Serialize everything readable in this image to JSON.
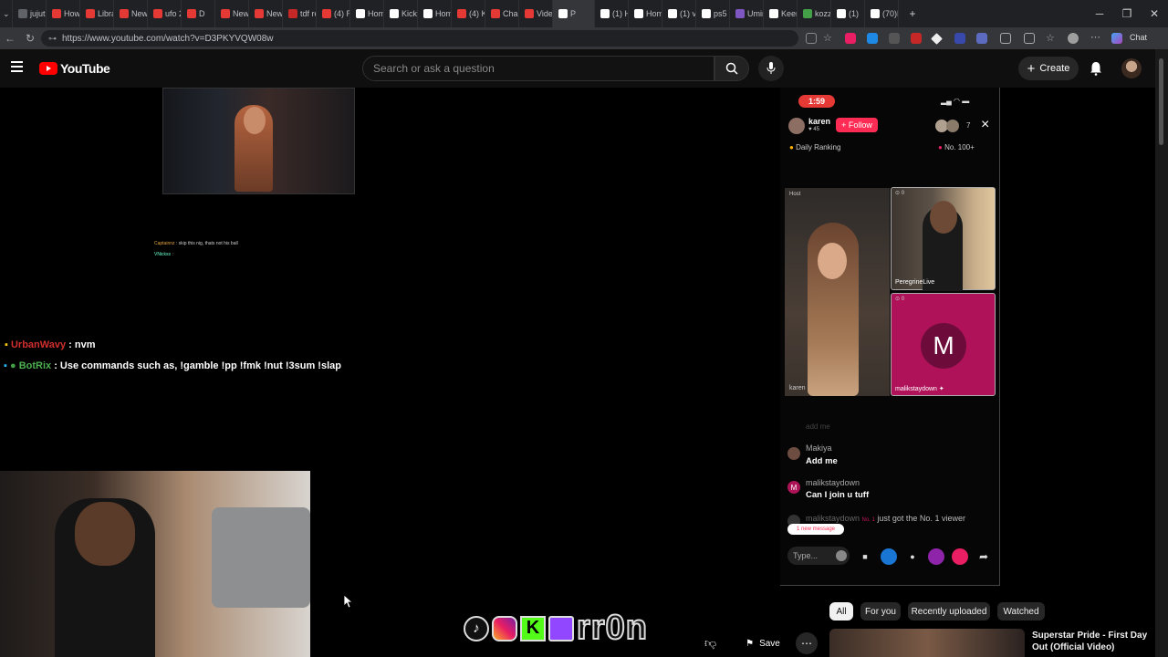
{
  "browser": {
    "tabs": [
      {
        "label": "jujut",
        "color": "#5f6368"
      },
      {
        "label": "How",
        "color": "#e53935"
      },
      {
        "label": "Libra",
        "color": "#e53935"
      },
      {
        "label": "New",
        "color": "#e53935"
      },
      {
        "label": "ufo 2",
        "color": "#e53935"
      },
      {
        "label": "D",
        "color": "#e53935"
      },
      {
        "label": "New",
        "color": "#e53935"
      },
      {
        "label": "New",
        "color": "#e53935"
      },
      {
        "label": "tdf re",
        "color": "#c62828"
      },
      {
        "label": "(4) Re",
        "color": "#e53935"
      },
      {
        "label": "Home",
        "color": "#ffffff"
      },
      {
        "label": "KickC",
        "color": "#ffffff"
      },
      {
        "label": "Home",
        "color": "#ffffff"
      },
      {
        "label": "(4) Ke",
        "color": "#e53935"
      },
      {
        "label": "Chan",
        "color": "#e53935"
      },
      {
        "label": "Video",
        "color": "#e53935"
      },
      {
        "label": "P",
        "color": "#ffffff",
        "active": true
      },
      {
        "label": "(1) H",
        "color": "#ffffff"
      },
      {
        "label": "Home",
        "color": "#ffffff"
      },
      {
        "label": "(1) vo",
        "color": "#ffffff"
      },
      {
        "label": "ps5 -",
        "color": "#ffffff"
      },
      {
        "label": "Umin",
        "color": "#7e57c2"
      },
      {
        "label": "Keem",
        "color": "#ffffff"
      },
      {
        "label": "kozzi",
        "color": "#43a047"
      },
      {
        "label": "(1)  ",
        "color": "#ffffff"
      },
      {
        "label": "(70)E",
        "color": "#ffffff"
      }
    ],
    "new_tab": "+",
    "url": "https://www.youtube.com/watch?v=D3PKYVQW08w",
    "chat_label": "Chat"
  },
  "youtube": {
    "logo_text": "YouTube",
    "search_placeholder": "Search or ask a question",
    "create_label": "Create",
    "filter_chips": [
      "All",
      "For you",
      "Recently uploaded",
      "Watched"
    ],
    "save_label": "Save",
    "suggested_title_1": "Superstar Pride - First Day",
    "suggested_title_2": "Out (Official Video)"
  },
  "stream": {
    "chat_small_1_user": "Captainnz",
    "chat_small_1_text": ": skip this nig, thats not his ball",
    "chat_small_2_user": "VNickss",
    "chat_small_2_text": ":",
    "chat1_user": "UrbanWavy",
    "chat1_text": ": nvm",
    "chat2_user": "BotRix",
    "chat2_text": ": Use commands such as, !gamble !pp !fmk !nut !3sum !slap",
    "watermark": "rr0n"
  },
  "tiktok": {
    "timer": "1:59",
    "host_name": "karen",
    "host_stat": "45",
    "follow_label": "+ Follow",
    "viewer_count": "7",
    "close": "×",
    "daily_ranking": "Daily Ranking",
    "rank_label": "No. 100+",
    "host_tag": "Host",
    "tile_host_name": "karen",
    "tile_2_name": "PeregrineLive",
    "tile_3_name": "malikstaydown",
    "tile_3_initial": "M",
    "tile_2_count": "0",
    "tile_3_count": "0",
    "faded_msg": "add me",
    "messages": [
      {
        "user": "Makiya",
        "text": "Add me",
        "color": "#6d4c41"
      },
      {
        "user": "malikstaydown",
        "text": "Can I join u tuff",
        "color": "#ad1457"
      }
    ],
    "system_user": "malikstaydown",
    "system_badge": "No. 1",
    "system_text": "just got the No. 1 viewer",
    "new_message": "1 new message",
    "type_placeholder": "Type..."
  }
}
